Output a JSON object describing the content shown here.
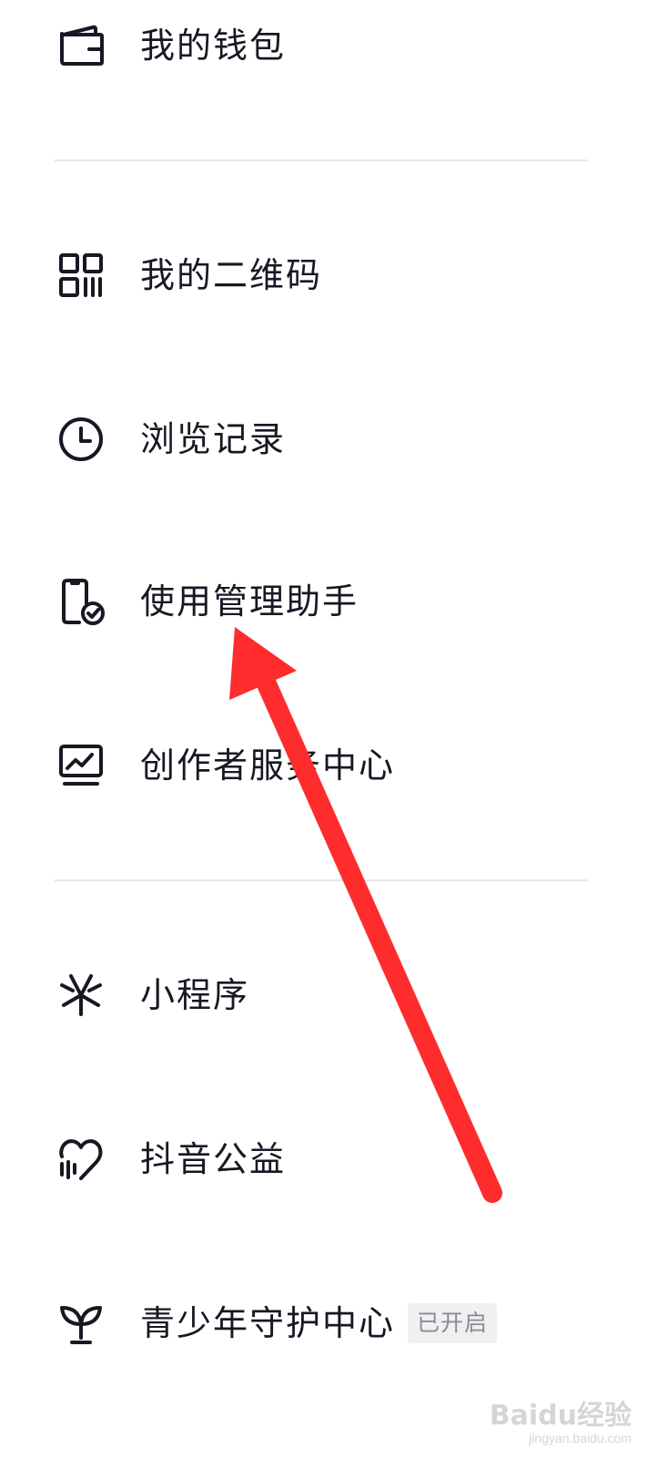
{
  "menu": {
    "wallet": {
      "label": "我的钱包",
      "icon": "wallet-icon"
    },
    "qrcode": {
      "label": "我的二维码",
      "icon": "qr-code-icon"
    },
    "history": {
      "label": "浏览记录",
      "icon": "clock-icon"
    },
    "usage": {
      "label": "使用管理助手",
      "icon": "phone-check-icon"
    },
    "creator": {
      "label": "创作者服务中心",
      "icon": "monitor-chart-icon"
    },
    "miniapp": {
      "label": "小程序",
      "icon": "mini-program-icon"
    },
    "charity": {
      "label": "抖音公益",
      "icon": "heart-icon"
    },
    "teen": {
      "label": "青少年守护中心",
      "icon": "sprout-icon",
      "badge": "已开启"
    }
  },
  "annotation": {
    "arrow_color": "#fe2c2c"
  },
  "watermark": {
    "brand": "Baidu经验",
    "url": "jingyan.baidu.com"
  }
}
